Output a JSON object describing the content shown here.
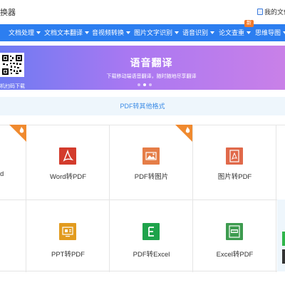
{
  "header": {
    "app_title": "换器",
    "my_files": "我的文件"
  },
  "nav": {
    "items": [
      {
        "label": "文档处理",
        "has_dropdown": true
      },
      {
        "label": "文档文本翻译",
        "has_dropdown": true
      },
      {
        "label": "音视频转换",
        "has_dropdown": true
      },
      {
        "label": "图片文字识别",
        "has_dropdown": true
      },
      {
        "label": "语音识别",
        "has_dropdown": true
      },
      {
        "label": "论文查重",
        "has_dropdown": true
      },
      {
        "label": "思维导图",
        "has_dropdown": true
      }
    ],
    "badge": "新",
    "bg_color": "#2c7ef0"
  },
  "banner": {
    "title": "语音翻译",
    "subtitle": "下载移动端语音翻译，随时随地尽享翻译",
    "qr_caption": "机扫码下载",
    "slide_count": 3,
    "active_slide": 1
  },
  "section": {
    "title": "PDF转其他格式"
  },
  "grid": {
    "partial_left_label": "d",
    "row1": [
      {
        "label": "Word转PDF",
        "icon": "pdf-icon",
        "color": "#d33b2c",
        "hot": false
      },
      {
        "label": "PDF转图片",
        "icon": "image-icon",
        "color": "#e57d47",
        "hot": true
      },
      {
        "label": "图片转PDF",
        "icon": "pdf-icon",
        "color": "#e0694a",
        "hot": false
      }
    ],
    "row2": [
      {
        "label": "PPT转PDF",
        "icon": "ppt-icon",
        "color": "#e29b1e",
        "hot": false
      },
      {
        "label": "PDF转Excel",
        "icon": "excel-icon",
        "color": "#1ea34b",
        "hot": false
      },
      {
        "label": "Excel转PDF",
        "icon": "excel-pdf-icon",
        "color": "#3d9b4f",
        "hot": false
      }
    ],
    "hot_corner_color": "#f08a2f"
  }
}
